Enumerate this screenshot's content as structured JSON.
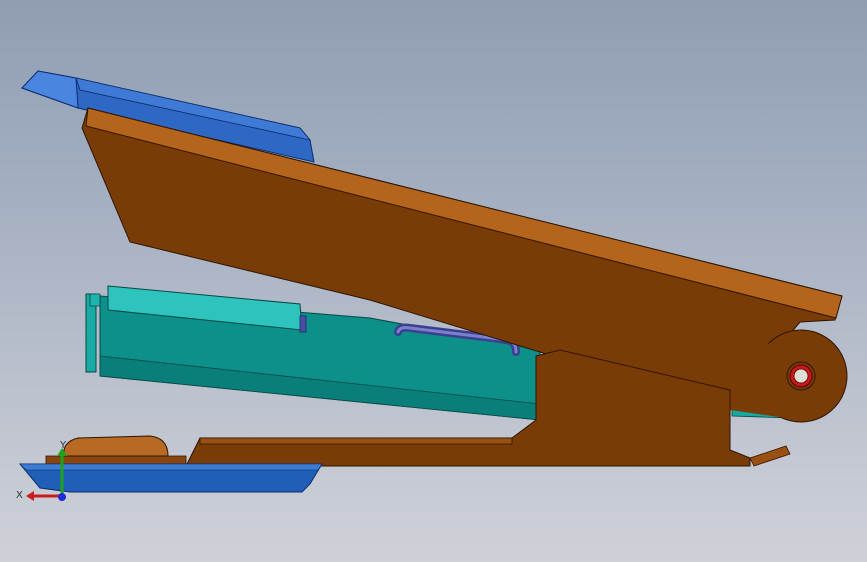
{
  "viewport": {
    "background_top": "#8f9db3",
    "background_bottom": "#cfd1d8"
  },
  "model": {
    "parts": [
      {
        "id": "top-cover",
        "color": "#2e68c4"
      },
      {
        "id": "upper-arm",
        "color": "#7a3c06"
      },
      {
        "id": "magazine",
        "color": "#0f9a94"
      },
      {
        "id": "spring-rod",
        "color": "#4a4fa3"
      },
      {
        "id": "base-frame",
        "color": "#7a3c06"
      },
      {
        "id": "base-plate",
        "color": "#1f5fb8"
      },
      {
        "id": "anvil-pad",
        "color": "#b86a24"
      },
      {
        "id": "pivot-pin",
        "color": "#c71919"
      }
    ]
  },
  "triad": {
    "x_label": "X",
    "y_label": "Y",
    "x_color": "#cc1b1b",
    "y_color": "#1fa31f",
    "z_color": "#1c2bd6"
  }
}
